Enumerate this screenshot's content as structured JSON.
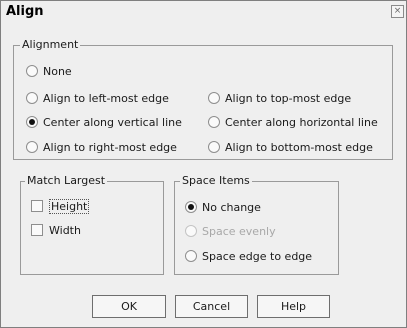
{
  "window": {
    "title": "Align",
    "close_glyph": "×"
  },
  "alignment": {
    "legend": "Alignment",
    "options": [
      {
        "label": "None",
        "checked": false
      },
      {
        "label": "Align to left-most edge",
        "checked": false
      },
      {
        "label": "Align to top-most edge",
        "checked": false
      },
      {
        "label": "Center along vertical line",
        "checked": true
      },
      {
        "label": "Center along horizontal line",
        "checked": false
      },
      {
        "label": "Align to right-most edge",
        "checked": false
      },
      {
        "label": "Align to bottom-most edge",
        "checked": false
      }
    ]
  },
  "match_largest": {
    "legend": "Match Largest",
    "height_label": "Height",
    "width_label": "Width",
    "height_checked": false,
    "width_checked": false
  },
  "space_items": {
    "legend": "Space Items",
    "options": [
      {
        "label": "No change",
        "checked": true,
        "enabled": true
      },
      {
        "label": "Space evenly",
        "checked": false,
        "enabled": false
      },
      {
        "label": "Space edge to edge",
        "checked": false,
        "enabled": true
      }
    ]
  },
  "buttons": {
    "ok": "OK",
    "cancel": "Cancel",
    "help": "Help"
  }
}
